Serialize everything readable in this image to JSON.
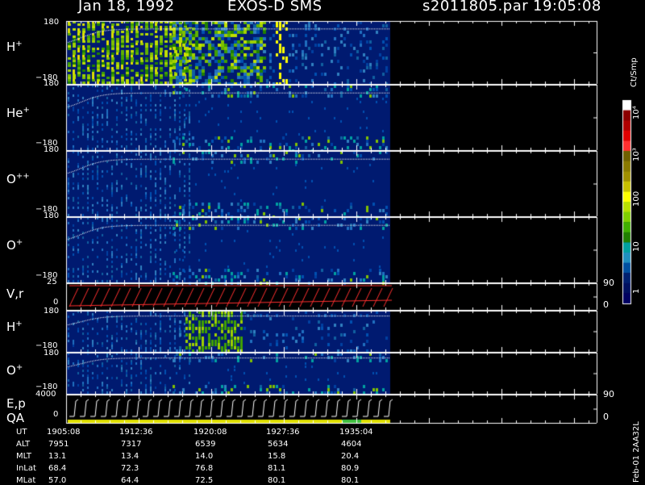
{
  "header": {
    "date": "Jan 18, 1992",
    "instrument": "EXOS-D SMS",
    "file": "s2011805.par",
    "time": "19:05:08"
  },
  "panels": [
    {
      "label": "H",
      "sup": "+",
      "ytop": "180",
      "ybot": "−180"
    },
    {
      "label": "He",
      "sup": "+",
      "ytop": "180",
      "ybot": "−180"
    },
    {
      "label": "O",
      "sup": "++",
      "ytop": "180",
      "ybot": "−180"
    },
    {
      "label": "O",
      "sup": "+",
      "ytop": "180",
      "ybot": "−180"
    },
    {
      "label": "V,r",
      "sup": "",
      "ytop": "25",
      "ybot": "0",
      "rtop": "90",
      "rbot": "0"
    },
    {
      "label": "H",
      "sup": "+",
      "ytop": "180",
      "ybot": "−180"
    },
    {
      "label": "O",
      "sup": "+",
      "ytop": "180",
      "ybot": "−180"
    },
    {
      "label": "E,p",
      "label2": "QA",
      "sup": "",
      "ytop": "4000",
      "ybot": "0",
      "rtop": "90",
      "rbot": "0"
    }
  ],
  "colorbar": {
    "unit": "Ct/Smp",
    "labels": [
      "10⁴",
      "10³",
      "100",
      "10",
      "1"
    ],
    "colors": [
      "#ffffff",
      "#8b0000",
      "#b00000",
      "#e00000",
      "#ff3030",
      "#706000",
      "#8a7a00",
      "#a09000",
      "#c8c000",
      "#ffff00",
      "#b8e000",
      "#80d000",
      "#40b000",
      "#208000",
      "#00a0a0",
      "#2090c0",
      "#0050a0",
      "#002070",
      "#001060",
      "#000060"
    ]
  },
  "chart_data": {
    "type": "heatmap",
    "title": "Jan 18, 1992   EXOS-D SMS",
    "x_labels": [
      "1905:08",
      "1912:36",
      "1920:08",
      "1927:36",
      "1935:04"
    ],
    "colorscale_labels": [
      "1",
      "10",
      "100",
      "10³",
      "10⁴"
    ],
    "panels": [
      "H+",
      "He+",
      "O++",
      "O+",
      "V,r",
      "H+",
      "O+",
      "E,p QA"
    ],
    "y_range_pitch": [
      -180,
      180
    ],
    "y_range_vr": [
      0,
      25
    ],
    "y_range_ep": [
      0,
      4000
    ],
    "right_axis_range": [
      0,
      90
    ]
  },
  "footer": {
    "rows": [
      {
        "name": "UT",
        "values": [
          "1905:08",
          "1912:36",
          "1920:08",
          "1927:36",
          "1935:04"
        ]
      },
      {
        "name": "ALT",
        "values": [
          "7951",
          "7317",
          "6539",
          "5634",
          "4604"
        ]
      },
      {
        "name": "MLT",
        "values": [
          "13.1",
          "13.4",
          "14.0",
          "15.8",
          "20.4"
        ]
      },
      {
        "name": "InLat",
        "values": [
          "68.4",
          "72.3",
          "76.8",
          "81.1",
          "80.9"
        ]
      },
      {
        "name": "MLat",
        "values": [
          "57.0",
          "64.4",
          "72.5",
          "80.1",
          "80.1"
        ]
      }
    ],
    "code": "Feb-01  2AA32L"
  }
}
